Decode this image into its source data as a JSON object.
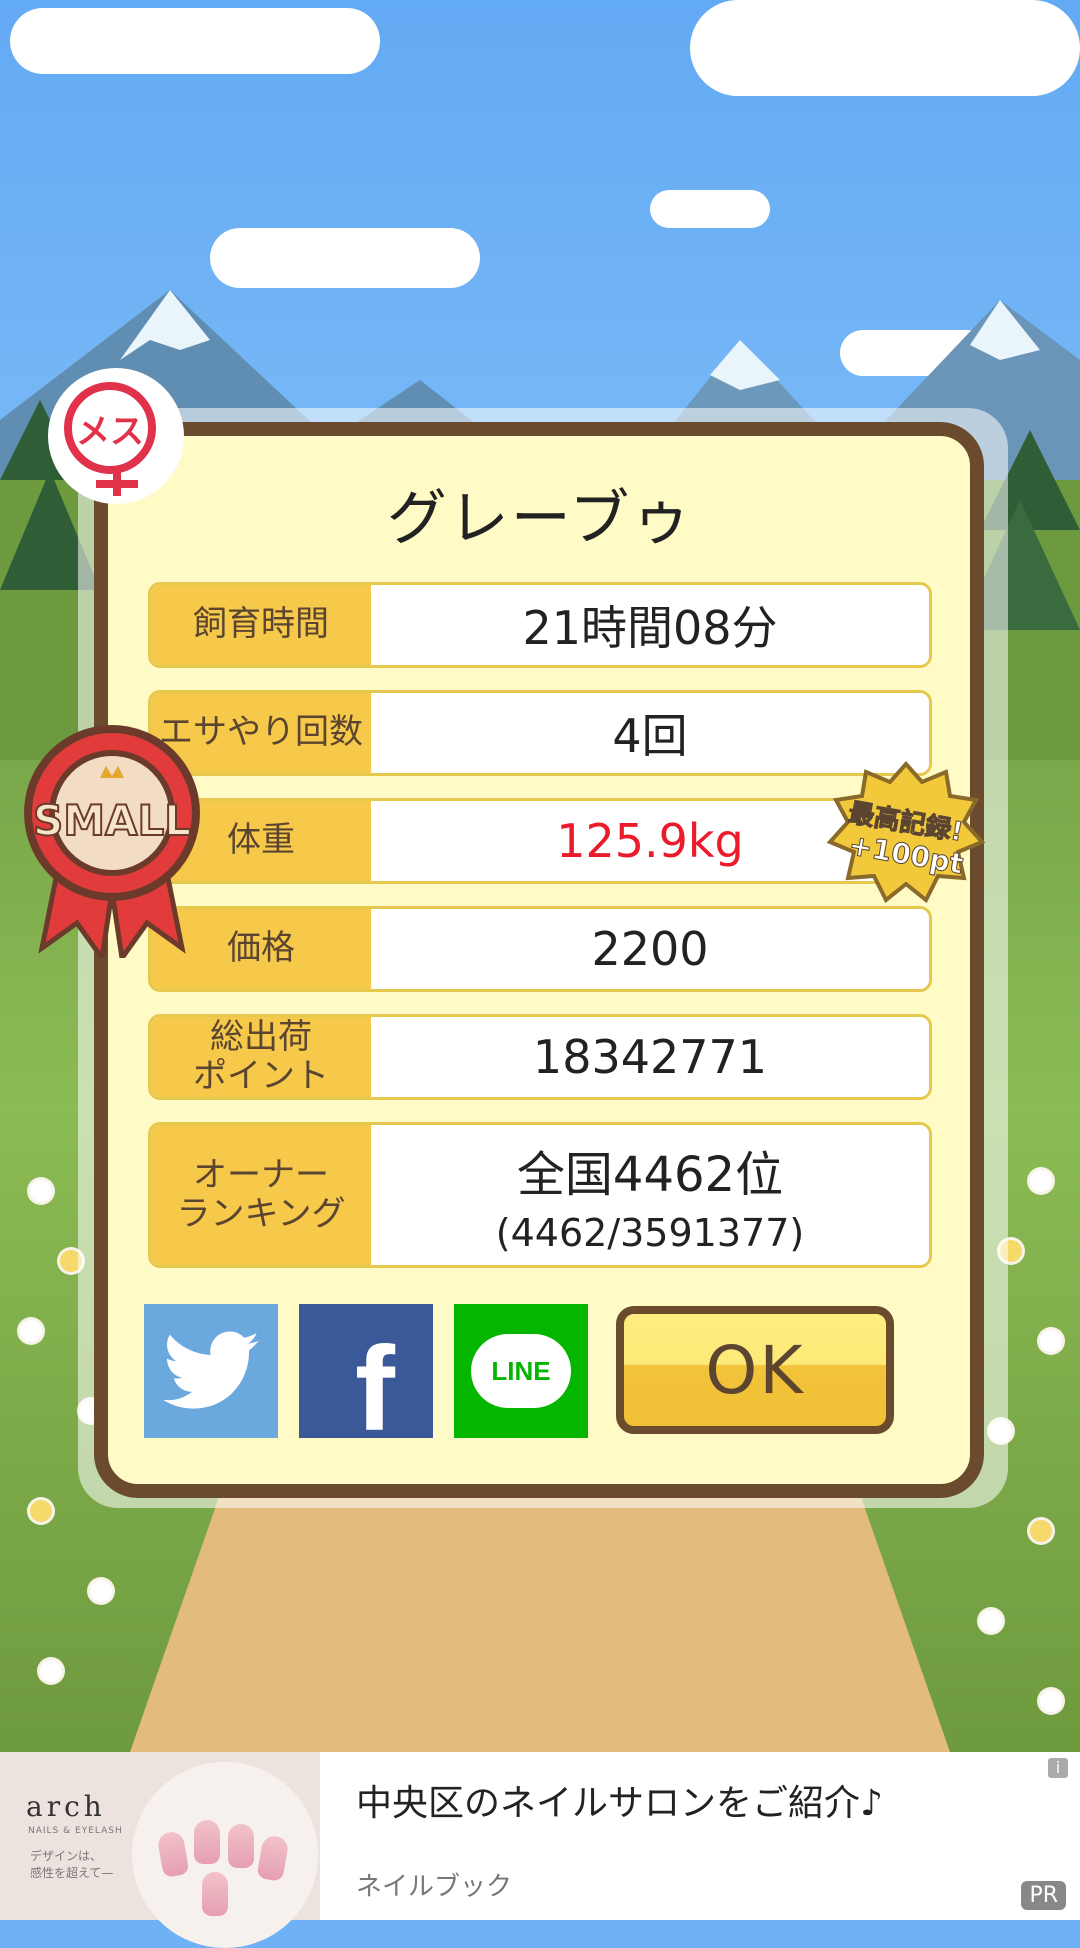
{
  "pig": {
    "name": "グレーブゥ",
    "gender_badge": "メス",
    "size_badge": "SMALL",
    "record_badge_line1": "最高記録!",
    "record_badge_line2": "+100pt"
  },
  "stats": [
    {
      "label": "飼育時間",
      "value": "21時間08分"
    },
    {
      "label": "エサやり回数",
      "value": "4回"
    },
    {
      "label": "体重",
      "value": "125.9kg",
      "value_color": "#ea1b2b"
    },
    {
      "label": "価格",
      "value": "2200"
    },
    {
      "label_line1": "総出荷",
      "label_line2": "ポイント",
      "value": "18342771"
    },
    {
      "label_line1": "オーナー",
      "label_line2": "ランキング",
      "value_line1": "全国4462位",
      "value_line2": "(4462/3591377)"
    }
  ],
  "share": {
    "twitter_icon": "twitter-bird-icon",
    "facebook_label": "f",
    "line_label": "LINE"
  },
  "ok_button": {
    "label": "OK"
  },
  "ad": {
    "brand": "arch",
    "brand_sub": "NAILS & EYELASH",
    "tagline": "デザインは、\n感性を超えて—",
    "title": "中央区のネイルサロンをご紹介♪",
    "source": "ネイルブック",
    "info_label": "i",
    "pr_label": "PR"
  },
  "colors": {
    "panel_bg": "#fffbc6",
    "panel_border": "#6b4b2e",
    "label_bg": "#f7c94a",
    "accent_red": "#ea1b2b",
    "twitter": "#6ba8dd",
    "facebook": "#3b5998",
    "line": "#04b600"
  }
}
